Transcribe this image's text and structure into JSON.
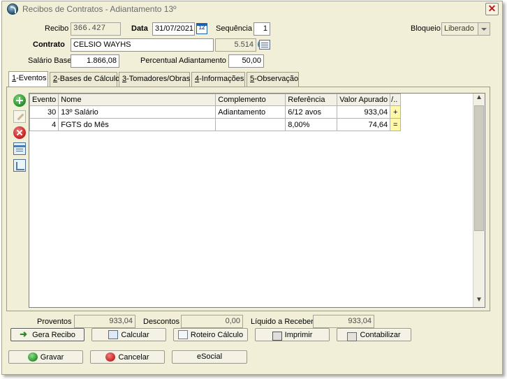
{
  "window": {
    "title": "Recibos de Contratos - Adiantamento 13º"
  },
  "header": {
    "recibo_label": "Recibo",
    "recibo_value": "366.427",
    "data_label": "Data",
    "data_value": "31/07/2021",
    "sequencia_label": "Sequência",
    "sequencia_value": "1",
    "bloqueio_label": "Bloqueio",
    "bloqueio_value": "Liberado",
    "contrato_label": "Contrato",
    "contrato_value": "CELSIO WAYHS",
    "contrato_code": "5.514",
    "salario_label": "Salário Base",
    "salario_value": "1.866,08",
    "percentual_label": "Percentual Adiantamento",
    "percentual_value": "50,00"
  },
  "tabs": [
    {
      "key": "1",
      "label": "-Eventos"
    },
    {
      "key": "2",
      "label": "-Bases de Cálculo"
    },
    {
      "key": "3",
      "label": "-Tomadores/Obras"
    },
    {
      "key": "4",
      "label": "-Informações"
    },
    {
      "key": "5",
      "label": "-Observação"
    }
  ],
  "table": {
    "columns": [
      "Evento",
      "Nome",
      "Complemento",
      "Referência",
      "Valor Apurado",
      "/.."
    ],
    "rows": [
      {
        "evento": "30",
        "nome": "13º Salário",
        "complemento": "Adiantamento",
        "referencia": "6/12 avos",
        "valor": "933,04",
        "flag": "+"
      },
      {
        "evento": "4",
        "nome": "FGTS do Mês",
        "complemento": "",
        "referencia": "8,00%",
        "valor": "74,64",
        "flag": "="
      }
    ]
  },
  "totals": {
    "proventos_label": "Proventos",
    "proventos_value": "933,04",
    "descontos_label": "Descontos",
    "descontos_value": "0,00",
    "liquido_label": "Líquido a Receber",
    "liquido_value": "933,04"
  },
  "actions": {
    "gera_recibo": "Gera Recibo",
    "calcular": "Calcular",
    "roteiro": "Roteiro Cálculo",
    "imprimir": "Imprimir",
    "contabilizar": "Contabilizar",
    "gravar": "Gravar",
    "cancelar": "Cancelar",
    "esocial": "eSocial"
  },
  "icons": {
    "close": "close-icon",
    "calendar": "calendar-icon",
    "search": "search-icon",
    "card": "card-icon",
    "add": "add-icon",
    "edit": "edit-icon",
    "delete": "delete-icon",
    "grid": "grid-icon",
    "calc": "calc-icon"
  },
  "colors": {
    "window_bg": "#f2efd9",
    "flag_bg": "#fff8a8",
    "close_x": "#b8191d"
  }
}
